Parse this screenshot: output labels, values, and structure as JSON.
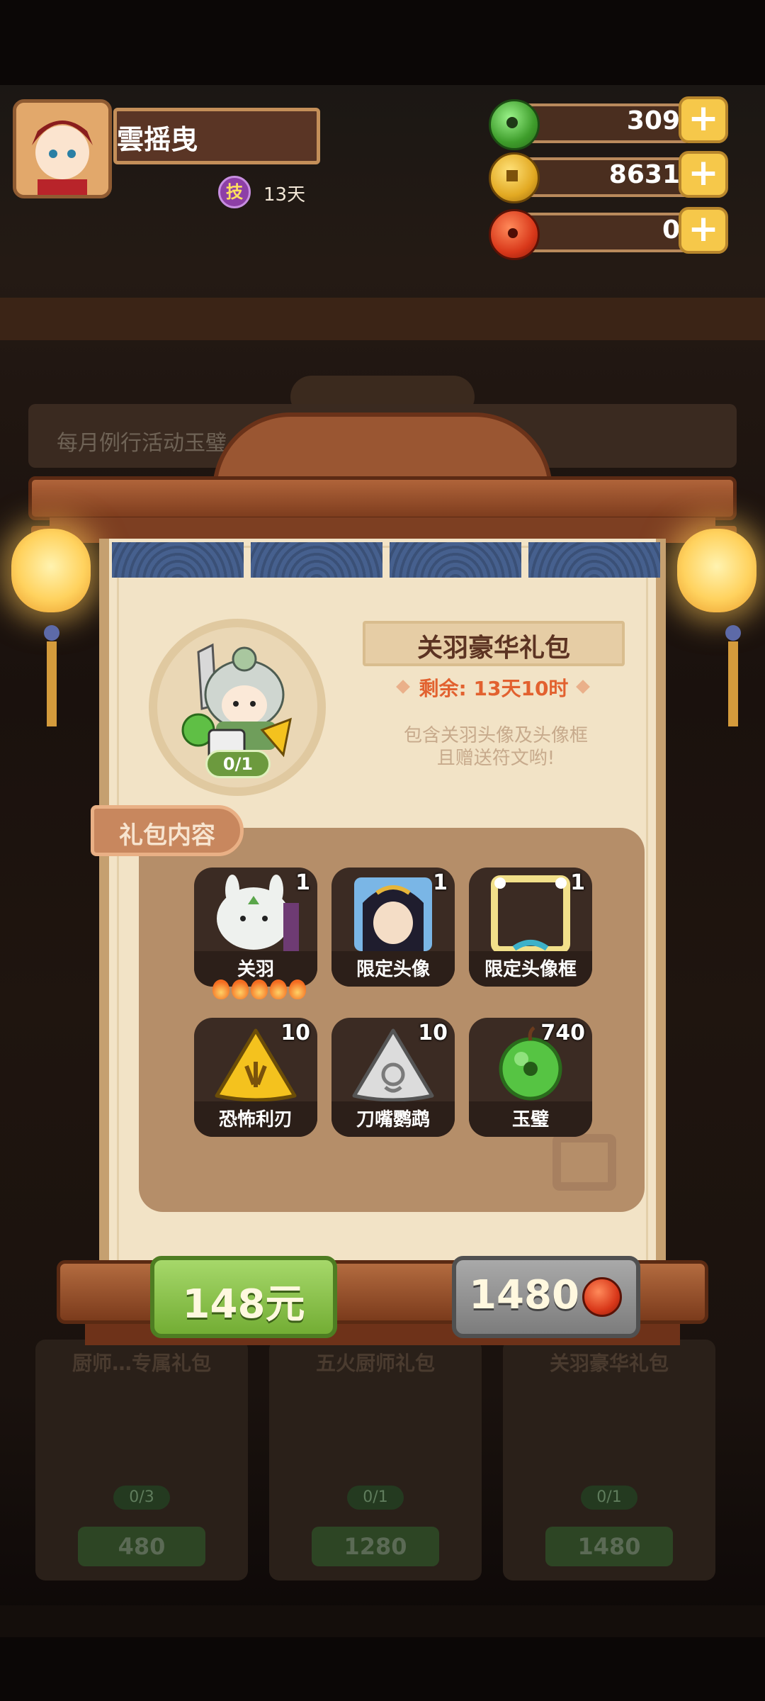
{
  "player": {
    "name": "雲摇曳",
    "skill_badge": "技",
    "skill_days": "13天"
  },
  "resources": [
    {
      "name": "jade",
      "value": "309",
      "icon": "jade-disc-icon",
      "plus": "+"
    },
    {
      "name": "coin",
      "value": "8631",
      "icon": "gold-coin-icon",
      "plus": "+"
    },
    {
      "name": "gem",
      "value": "0",
      "icon": "red-jade-icon",
      "plus": "+"
    }
  ],
  "background": {
    "banner_text": "每月例行活动玉璧…",
    "cards": [
      {
        "title": "厨师…专属礼包",
        "count": "0/3",
        "price": "480"
      },
      {
        "title": "五火厨师礼包",
        "count": "0/1",
        "price": "1280"
      },
      {
        "title": "关羽豪华礼包",
        "count": "0/1",
        "price": "1480"
      }
    ]
  },
  "pack": {
    "title": "关羽豪华礼包",
    "timer": "剩余: 13天10时",
    "description": "包含关羽头像及头像框\n且赠送符文哟!",
    "progress": "0/1",
    "content_tab": "礼包内容",
    "items": [
      {
        "name": "关羽",
        "qty": "1",
        "icon": "guan-yu-character-icon",
        "stars": 5
      },
      {
        "name": "限定头像",
        "qty": "1",
        "icon": "portrait-avatar-icon"
      },
      {
        "name": "限定头像框",
        "qty": "1",
        "icon": "avatar-frame-icon"
      },
      {
        "name": "恐怖利刃",
        "qty": "10",
        "icon": "gold-rune-icon"
      },
      {
        "name": "刀嘴鹦鹉",
        "qty": "10",
        "icon": "silver-rune-icon"
      },
      {
        "name": "玉璧",
        "qty": "740",
        "icon": "jade-disc-icon"
      }
    ]
  },
  "buttons": {
    "rmb_price": "148元",
    "gem_price": "1480"
  }
}
